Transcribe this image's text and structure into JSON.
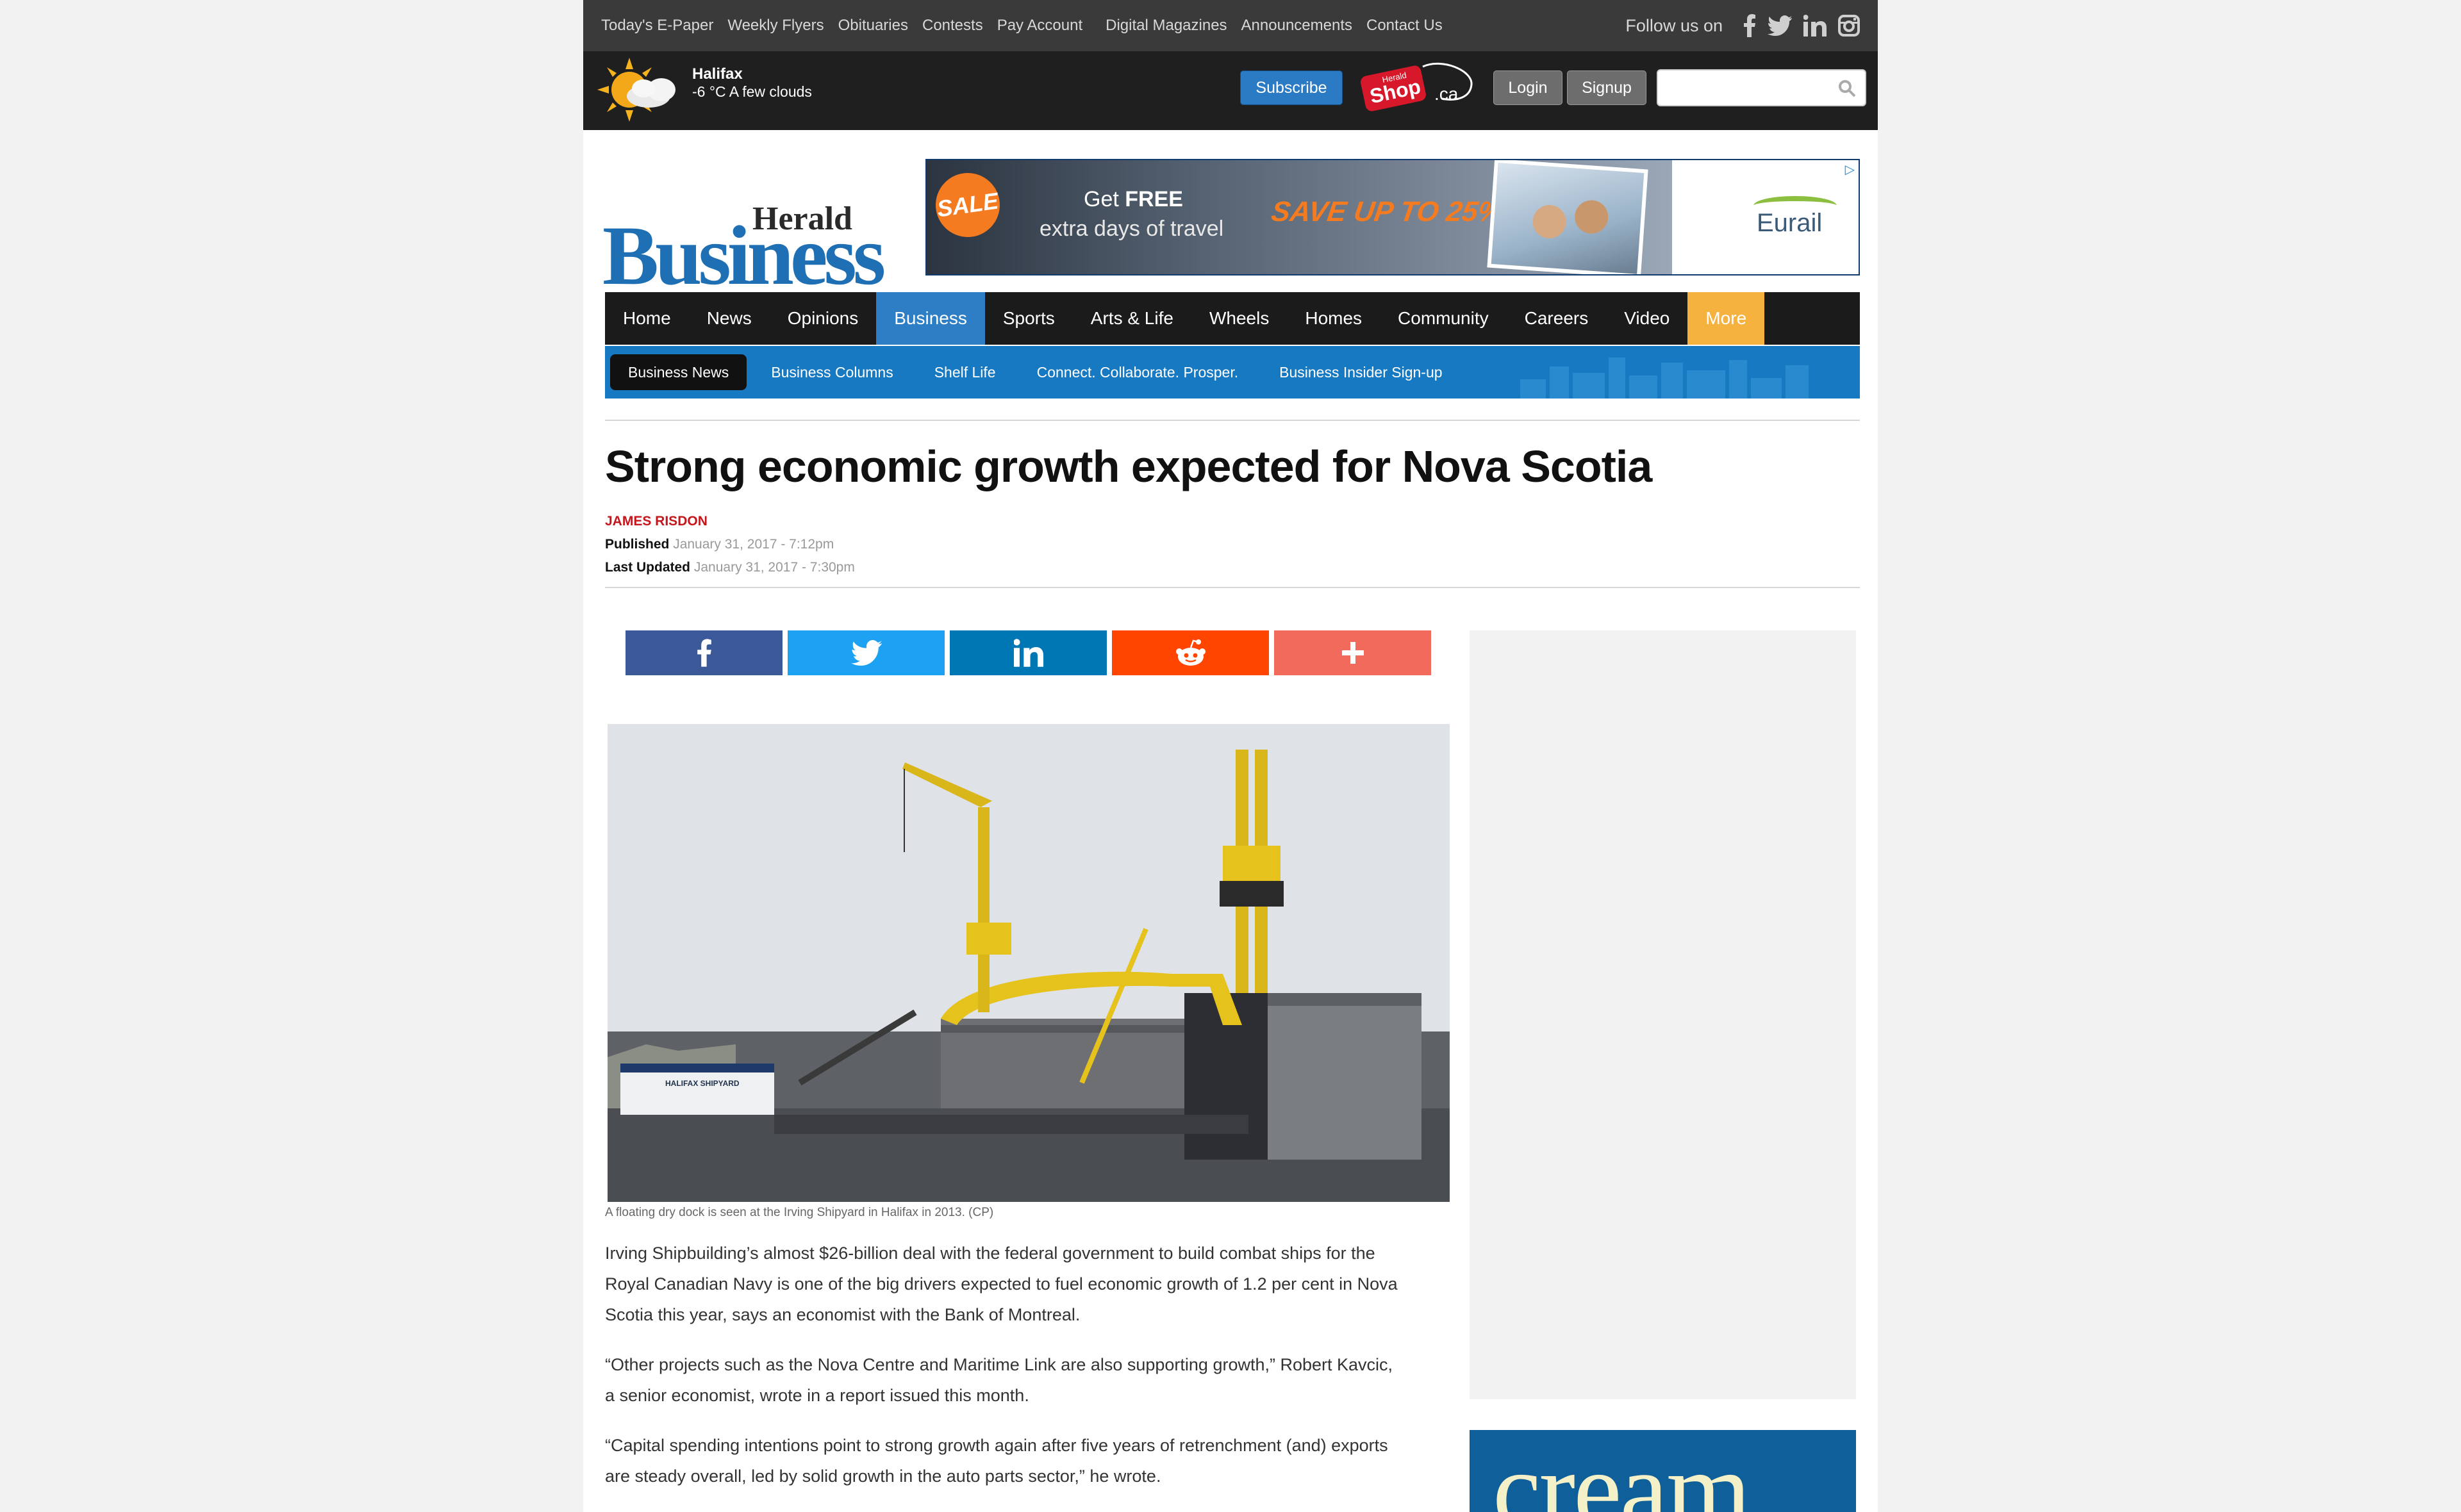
{
  "topbar": {
    "links": [
      "Today's E-Paper",
      "Weekly Flyers",
      "Obituaries",
      "Contests",
      "Pay Account",
      "Digital Magazines",
      "Announcements",
      "Contact Us"
    ],
    "follow_label": "Follow us on",
    "social_icons": [
      "facebook-icon",
      "twitter-icon",
      "linkedin-icon",
      "instagram-icon"
    ]
  },
  "weather": {
    "city": "Halifax",
    "condition": "-6 °C A few clouds",
    "icon": "partly-sunny-icon"
  },
  "header": {
    "subscribe_label": "Subscribe",
    "shop_logo": {
      "top": "Herald",
      "main": "Shop",
      "suffix": ".ca"
    },
    "login_label": "Login",
    "signup_label": "Signup",
    "search_placeholder": ""
  },
  "logo": {
    "small": "Herald",
    "large": "Business"
  },
  "ad": {
    "sale": "SALE",
    "line1_prefix": "Get ",
    "line1_bold": "FREE",
    "line2": "extra days of travel",
    "save": "SAVE UP TO 25%",
    "brand": "Eurail"
  },
  "main_nav": [
    {
      "label": "Home",
      "state": ""
    },
    {
      "label": "News",
      "state": ""
    },
    {
      "label": "Opinions",
      "state": ""
    },
    {
      "label": "Business",
      "state": "active"
    },
    {
      "label": "Sports",
      "state": ""
    },
    {
      "label": "Arts & Life",
      "state": ""
    },
    {
      "label": "Wheels",
      "state": ""
    },
    {
      "label": "Homes",
      "state": ""
    },
    {
      "label": "Community",
      "state": ""
    },
    {
      "label": "Careers",
      "state": ""
    },
    {
      "label": "Video",
      "state": ""
    },
    {
      "label": "More",
      "state": "more"
    }
  ],
  "sub_nav": [
    {
      "label": "Business News",
      "state": "active"
    },
    {
      "label": "Business Columns",
      "state": ""
    },
    {
      "label": "Shelf Life",
      "state": ""
    },
    {
      "label": "Connect. Collaborate. Prosper.",
      "state": ""
    },
    {
      "label": "Business Insider Sign-up",
      "state": ""
    }
  ],
  "article": {
    "title": "Strong economic growth expected for Nova Scotia",
    "author": "JAMES RISDON",
    "published_label": "Published",
    "published_date": "January 31, 2017 - 7:12pm",
    "updated_label": "Last Updated",
    "updated_date": "January 31, 2017 - 7:30pm",
    "share_buttons": [
      "facebook-icon",
      "twitter-icon",
      "linkedin-icon",
      "reddit-icon",
      "plus-icon"
    ],
    "image_building_sign": "HALIFAX SHIPYARD",
    "caption": "A floating dry dock is seen at the Irving Shipyard in Halifax in 2013. (CP)",
    "paragraphs": [
      "Irving Shipbuilding’s almost $26-billion deal with the federal government to build combat ships for the Royal Canadian Navy is one of the big drivers expected to fuel economic growth of 1.2 per cent in Nova Scotia this year, says an economist with the Bank of Montreal.",
      "“Other projects such as the Nova Centre and Maritime Link are also supporting growth,” Robert Kavcic, a senior economist, wrote in a report issued this month.",
      "“Capital spending intentions point to strong growth again after five years of retrenchment (and) exports are steady overall, led by solid growth in the auto parts sector,” he wrote."
    ]
  },
  "sidebar": {
    "cream_text": "cream"
  },
  "colors": {
    "accent_blue": "#1e6fb3",
    "nav_active": "#2d7ec4",
    "nav_more": "#f6b23e",
    "author_red": "#c4161c"
  }
}
